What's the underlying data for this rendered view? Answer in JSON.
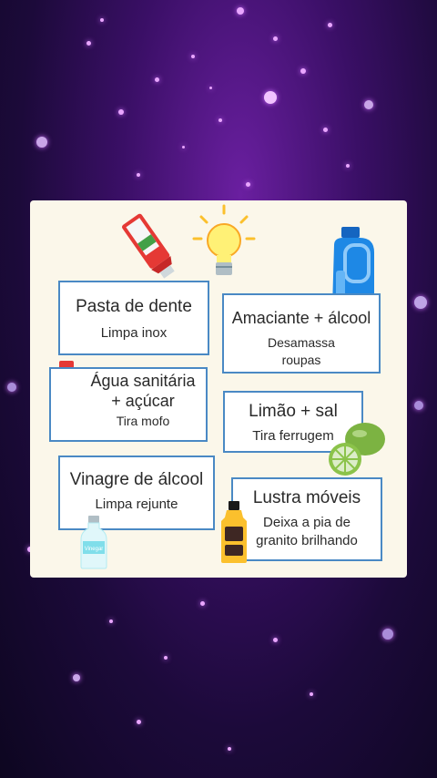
{
  "colors": {
    "background": "#1c0a3a",
    "accent": "#b56cff",
    "card": "#fbf7ea",
    "box_border": "#4a89c4"
  },
  "icons": [
    "toothpaste-icon",
    "light-bulb-icon",
    "softener-bottle-icon",
    "bleach-bottle-icon",
    "lime-icon",
    "vinegar-bottle-icon",
    "furniture-polish-icon"
  ],
  "tips": [
    {
      "title": "Pasta de dente",
      "desc": "Limpa inox"
    },
    {
      "title": "Amaciante + álcool",
      "desc": "Desamassa roupas"
    },
    {
      "title": "Água sanitária + açúcar",
      "desc": "Tira mofo"
    },
    {
      "title": "Limão + sal",
      "desc": "Tira ferrugem"
    },
    {
      "title": "Vinagre de álcool",
      "desc": "Limpa rejunte"
    },
    {
      "title": "Lustra móveis",
      "desc": "Deixa a pia de granito brilhando"
    }
  ],
  "vinegar_label": "Vinegar"
}
